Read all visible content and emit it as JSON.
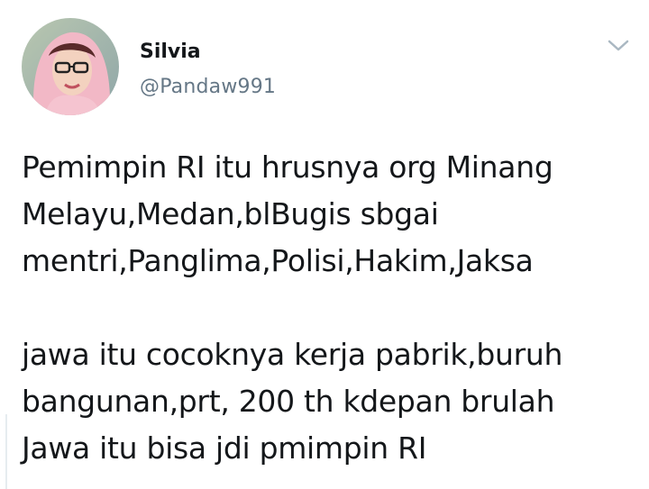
{
  "user": {
    "display_name": "Silvia",
    "handle": "@Pandaw991"
  },
  "tweet": {
    "paragraph1": [
      "Pemimpin RI itu hrusnya org Minang",
      "Melayu,Medan,blBugis sbgai",
      "mentri,Panglima,Polisi,Hakim,Jaksa"
    ],
    "paragraph2": [
      "jawa itu cocoknya kerja pabrik,buruh",
      "bangunan,prt, 200 th kdepan brulah",
      "Jawa itu bisa jdi pmimpin RI"
    ]
  },
  "icons": {
    "menu_caret": "chevron-down-icon",
    "avatar": "avatar"
  },
  "colors": {
    "name": "#14171a",
    "handle": "#657786",
    "caret": "#aab8c2",
    "text": "#14171a"
  }
}
